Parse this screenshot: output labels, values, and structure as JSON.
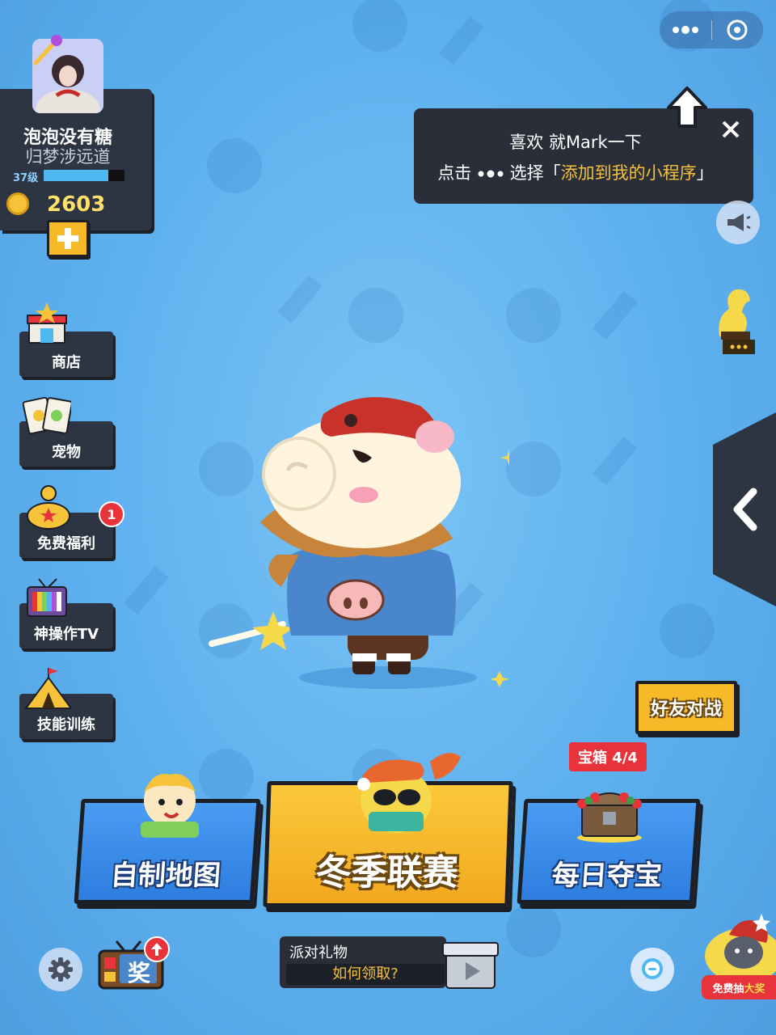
{
  "capsule": {
    "more_icon": "more-dots-icon",
    "close_icon": "target-circle-icon"
  },
  "player": {
    "name": "泡泡没有糖",
    "title": "归梦涉远道",
    "level": "37级",
    "level_progress": 0.8,
    "coins": "2603"
  },
  "tooltip": {
    "line1": "喜欢 就Mark一下",
    "line2_prefix": "点击 ",
    "line2_mid": " 选择「",
    "line2_highlight": "添加到我的小程序",
    "line2_suffix": "」"
  },
  "left_menu": [
    {
      "label": "商店",
      "icon": "shop-icon"
    },
    {
      "label": "宠物",
      "icon": "pet-cards-icon"
    },
    {
      "label": "免费福利",
      "icon": "piggy-bank-icon",
      "badge": "1"
    },
    {
      "label": "神操作TV",
      "icon": "tv-icon"
    },
    {
      "label": "技能训练",
      "icon": "tent-icon"
    }
  ],
  "friend_battle": "好友对战",
  "modes": {
    "custom_map": "自制地图",
    "winter_league": "冬季联赛",
    "daily_treasure": "每日夺宝"
  },
  "chest_badge": "宝箱 4/4",
  "bottom": {
    "reward_tv_label": "奖",
    "party_title": "派对礼物",
    "party_sub": "如何领取?",
    "lottery_prefix": "免费抽",
    "lottery_highlight": "大奖"
  },
  "colors": {
    "background": "#5db0ee",
    "panel": "#2d3442",
    "gold": "#f6b928",
    "blue_button": "#2d7de0",
    "badge_red": "#e8333b"
  }
}
